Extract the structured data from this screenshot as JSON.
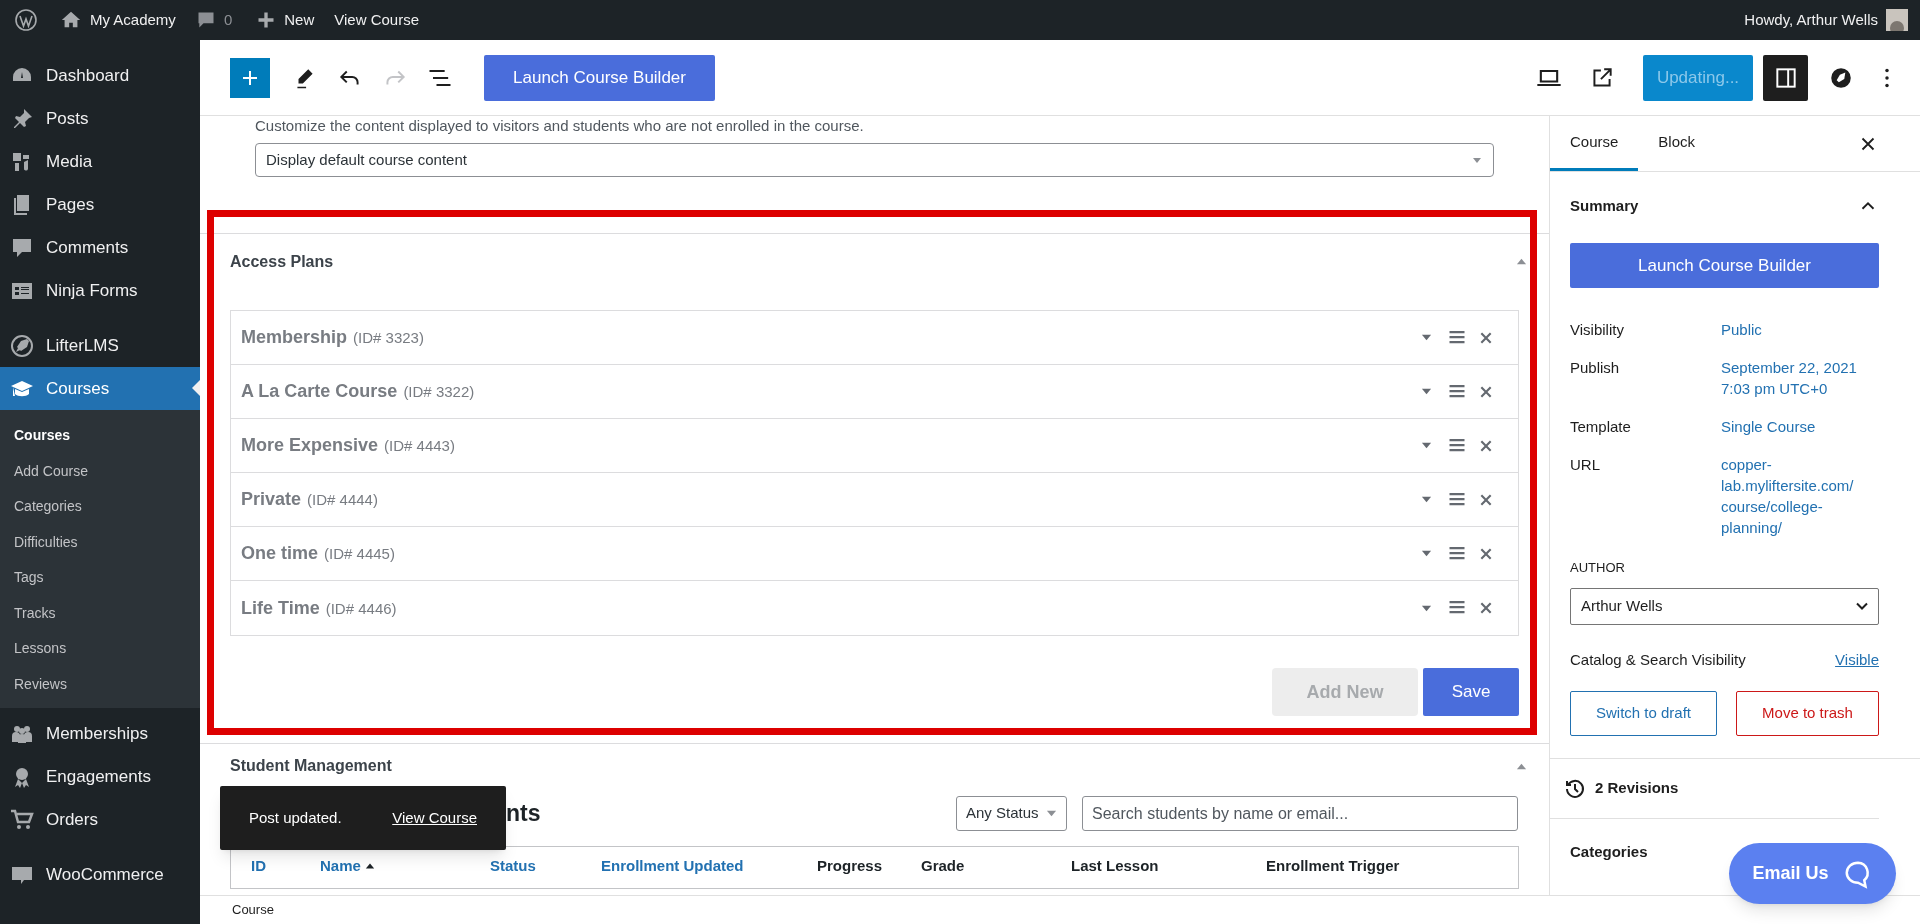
{
  "admin_bar": {
    "site": "My Academy",
    "comments": "0",
    "new": "New",
    "view": "View Course",
    "greeting": "Howdy, Arthur Wells"
  },
  "sidebar": {
    "items": [
      {
        "label": "Dashboard",
        "selected": false
      },
      {
        "label": "Posts",
        "selected": false
      },
      {
        "label": "Media",
        "selected": false
      },
      {
        "label": "Pages",
        "selected": false
      },
      {
        "label": "Comments",
        "selected": false
      },
      {
        "label": "Ninja Forms",
        "selected": false
      },
      {
        "label": "LifterLMS",
        "selected": false
      },
      {
        "label": "Courses",
        "selected": true,
        "children": [
          {
            "label": "Courses",
            "selected": true
          },
          {
            "label": "Add Course",
            "selected": false
          },
          {
            "label": "Categories",
            "selected": false
          },
          {
            "label": "Difficulties",
            "selected": false
          },
          {
            "label": "Tags",
            "selected": false
          },
          {
            "label": "Tracks",
            "selected": false
          },
          {
            "label": "Lessons",
            "selected": false
          },
          {
            "label": "Reviews",
            "selected": false
          }
        ]
      },
      {
        "label": "Memberships",
        "selected": false
      },
      {
        "label": "Engagements",
        "selected": false
      },
      {
        "label": "Orders",
        "selected": false
      },
      {
        "label": "WooCommerce",
        "selected": false
      }
    ]
  },
  "toolbar": {
    "history": [
      {
        "kind": "undo",
        "disabled": false
      },
      {
        "kind": "redo",
        "disabled": true
      }
    ],
    "launch": "Launch Course Builder",
    "update": {
      "label": "Updating...",
      "busy": true
    }
  },
  "content": {
    "intro": "Customize the content displayed to visitors and students who are not enrolled in the course.",
    "select": "Display default course content"
  },
  "access_plans": {
    "title": "Access Plans",
    "expanded": true,
    "highlighted": true,
    "plans": [
      {
        "name": "Membership",
        "id": "(ID# 3323)"
      },
      {
        "name": "A La Carte Course",
        "id": "(ID# 3322)"
      },
      {
        "name": "More Expensive",
        "id": "(ID# 4443)"
      },
      {
        "name": "Private",
        "id": "(ID# 4444)"
      },
      {
        "name": "One time",
        "id": "(ID# 4445)"
      },
      {
        "name": "Life Time",
        "id": "(ID# 4446)"
      }
    ],
    "add_new": {
      "label": "Add New",
      "disabled": true
    },
    "save": "Save"
  },
  "student_management": {
    "title": "Student Management",
    "expanded": true,
    "heading": "nts",
    "status_filter": "Any Status",
    "search": {
      "placeholder": "Search students by name or email..."
    },
    "columns": [
      {
        "label": "ID",
        "sortable": true,
        "sorted": false
      },
      {
        "label": "Name",
        "sortable": true,
        "sorted": true
      },
      {
        "label": "Status",
        "sortable": true,
        "sorted": false
      },
      {
        "label": "Enrollment Updated",
        "sortable": true,
        "sorted": false
      },
      {
        "label": "Progress",
        "sortable": false,
        "sorted": false
      },
      {
        "label": "Grade",
        "sortable": false,
        "sorted": false
      },
      {
        "label": "Last Lesson",
        "sortable": false,
        "sorted": false
      },
      {
        "label": "Enrollment Trigger",
        "sortable": false,
        "sorted": false
      }
    ]
  },
  "toast": {
    "message": "Post updated.",
    "link": "View Course"
  },
  "footer": {
    "breadcrumb": "Course"
  },
  "settings": {
    "tabs": [
      {
        "label": "Course",
        "selected": true
      },
      {
        "label": "Block",
        "selected": false
      }
    ],
    "summary": {
      "title": "Summary",
      "expanded": true,
      "launch": "Launch Course Builder",
      "rows": [
        {
          "label": "Visibility",
          "value": "Public"
        },
        {
          "label": "Publish",
          "value": "September 22, 2021 7:03 pm UTC+0"
        },
        {
          "label": "Template",
          "value": "Single Course"
        },
        {
          "label": "URL",
          "value": "copper-lab.myliftersite.com/course/college-planning/"
        }
      ],
      "author": {
        "label": "AUTHOR",
        "value": "Arthur Wells"
      },
      "catalog": {
        "label": "Catalog & Search Visibility",
        "value": "Visible"
      },
      "actions": [
        {
          "kind": "draft",
          "label": "Switch to draft"
        },
        {
          "kind": "trash",
          "label": "Move to trash"
        }
      ]
    },
    "revisions": "2 Revisions",
    "next_panel": "Categories"
  },
  "help_button": "Email Us"
}
